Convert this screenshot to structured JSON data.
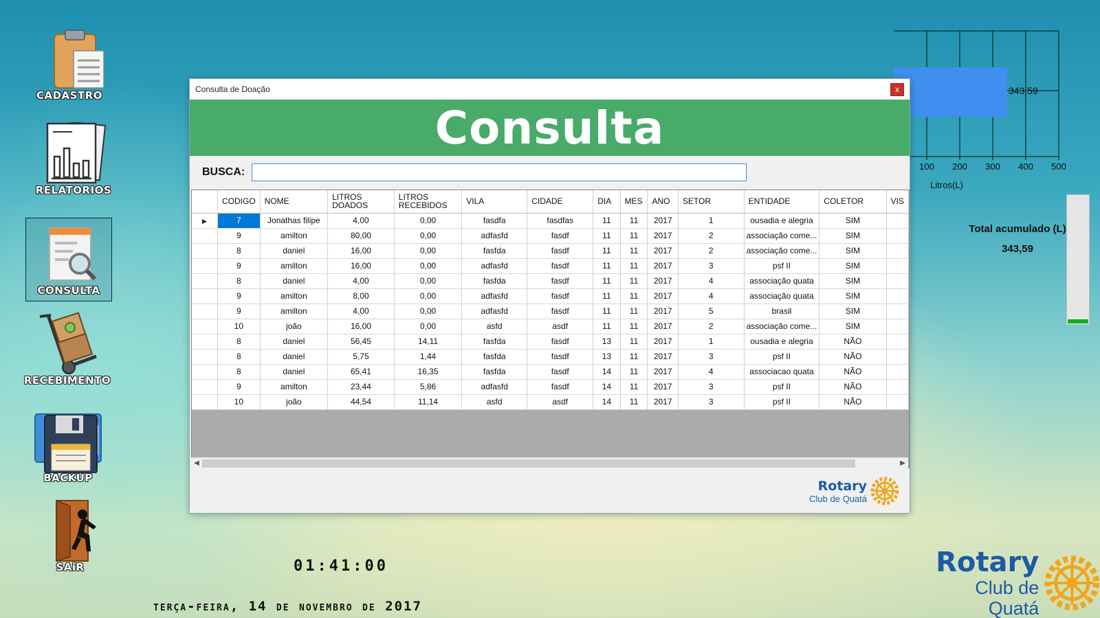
{
  "desktop": {
    "icons": [
      {
        "label": "CADASTRO"
      },
      {
        "label": "RELATORIOS"
      },
      {
        "label": "CONSULTA"
      },
      {
        "label": "RECEBIMENTO"
      },
      {
        "label": "BACKUP"
      },
      {
        "label": "SAiR"
      }
    ]
  },
  "window": {
    "title": "Consulta de Doação",
    "close": "x",
    "banner": "Consulta",
    "search_label": "BUSCA:",
    "search_value": "",
    "logo_line1": "Rotary",
    "logo_line2": "Club de Quatá"
  },
  "grid": {
    "columns": [
      "CODIGO",
      "NOME",
      "LITROS DOADOS",
      "LITROS RECEBIDOS",
      "VILA",
      "CIDADE",
      "DIA",
      "MES",
      "ANO",
      "SETOR",
      "ENTIDADE",
      "COLETOR",
      "VIS"
    ],
    "rows": [
      [
        "7",
        "Jonathas filipe",
        "4,00",
        "0,00",
        "fasdfa",
        "fasdfas",
        "11",
        "11",
        "2017",
        "1",
        "ousadia e alegria",
        "SIM"
      ],
      [
        "9",
        "amilton",
        "80,00",
        "0,00",
        "adfasfd",
        "fasdf",
        "11",
        "11",
        "2017",
        "2",
        "associação come...",
        "SIM"
      ],
      [
        "8",
        "daniel",
        "16,00",
        "0,00",
        "fasfda",
        "fasdf",
        "11",
        "11",
        "2017",
        "2",
        "associação come...",
        "SIM"
      ],
      [
        "9",
        "amilton",
        "16,00",
        "0,00",
        "adfasfd",
        "fasdf",
        "11",
        "11",
        "2017",
        "3",
        "psf II",
        "SIM"
      ],
      [
        "8",
        "daniel",
        "4,00",
        "0,00",
        "fasfda",
        "fasdf",
        "11",
        "11",
        "2017",
        "4",
        "associação quata",
        "SIM"
      ],
      [
        "9",
        "amilton",
        "8,00",
        "0,00",
        "adfasfd",
        "fasdf",
        "11",
        "11",
        "2017",
        "4",
        "associação quata",
        "SIM"
      ],
      [
        "9",
        "amilton",
        "4,00",
        "0,00",
        "adfasfd",
        "fasdf",
        "11",
        "11",
        "2017",
        "5",
        "brasil",
        "SIM"
      ],
      [
        "10",
        "joão",
        "16,00",
        "0,00",
        "asfd",
        "asdf",
        "11",
        "11",
        "2017",
        "2",
        "associação come...",
        "SIM"
      ],
      [
        "8",
        "daniel",
        "56,45",
        "14,11",
        "fasfda",
        "fasdf",
        "13",
        "11",
        "2017",
        "1",
        "ousadia e alegria",
        "NÃO"
      ],
      [
        "8",
        "daniel",
        "5,75",
        "1,44",
        "fasfda",
        "fasdf",
        "13",
        "11",
        "2017",
        "3",
        "psf II",
        "NÃO"
      ],
      [
        "8",
        "daniel",
        "65,41",
        "16,35",
        "fasfda",
        "fasdf",
        "14",
        "11",
        "2017",
        "4",
        "associacao quata",
        "NÃO"
      ],
      [
        "9",
        "amilton",
        "23,44",
        "5,86",
        "adfasfd",
        "fasdf",
        "14",
        "11",
        "2017",
        "3",
        "psf II",
        "NÃO"
      ],
      [
        "10",
        "joão",
        "44,54",
        "11,14",
        "asfd",
        "asdf",
        "14",
        "11",
        "2017",
        "3",
        "psf II",
        "NÃO"
      ]
    ]
  },
  "chart_data": {
    "type": "bar",
    "orientation": "horizontal",
    "values": [
      343.59
    ],
    "data_labels": [
      "343,59"
    ],
    "xlabel": "Litros(L)",
    "xticks": [
      "100",
      "200",
      "300",
      "400",
      "500"
    ],
    "xlim": [
      0,
      500
    ],
    "grid": true,
    "bar_color": "#3f8ef0"
  },
  "totals": {
    "label": "Total acumulado (L)",
    "value": "343,59",
    "progress_fraction": 0.03
  },
  "clock": "01:41:00",
  "date": "terça-feira, 14 de novembro de 2017",
  "logo": {
    "line1": "Rotary",
    "line2": "Club de Quatá"
  }
}
